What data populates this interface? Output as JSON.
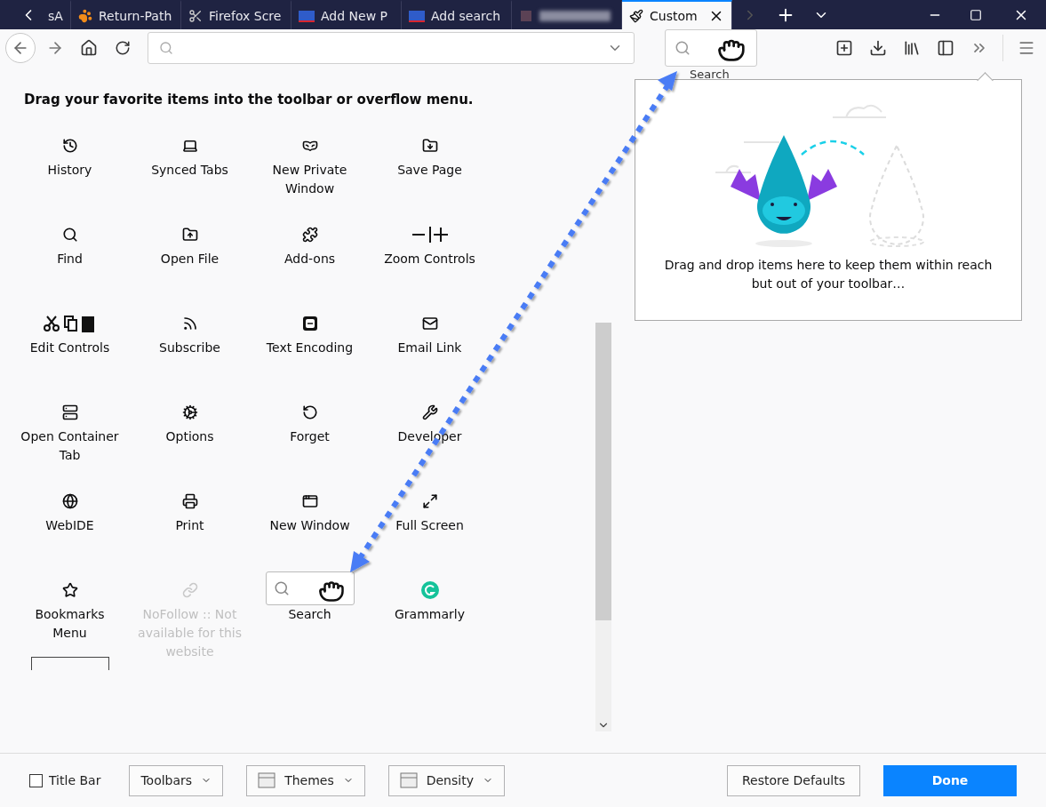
{
  "tabs": [
    {
      "kind": "text",
      "label": "sA",
      "selected": false
    },
    {
      "kind": "text",
      "label": "Return-Path",
      "selected": false
    },
    {
      "kind": "text",
      "label": "Firefox Scre",
      "selected": false
    },
    {
      "kind": "text",
      "label": "Add New P",
      "selected": false
    },
    {
      "kind": "text",
      "label": "Add search",
      "selected": false
    },
    {
      "kind": "redacted",
      "selected": false
    },
    {
      "kind": "text",
      "label": "Custom",
      "selected": true
    }
  ],
  "toolbar": {
    "search_label": "Search"
  },
  "palette": {
    "heading": "Drag your favorite items into the toolbar or overflow menu.",
    "items": [
      {
        "label": "History",
        "kind": "button",
        "disabled": false
      },
      {
        "label": "Synced Tabs",
        "kind": "button",
        "disabled": false
      },
      {
        "label": "New Private Window",
        "kind": "button",
        "disabled": false
      },
      {
        "label": "Save Page",
        "kind": "button",
        "disabled": false
      },
      {
        "label": "Find",
        "kind": "button",
        "disabled": false
      },
      {
        "label": "Open File",
        "kind": "button",
        "disabled": false
      },
      {
        "label": "Add-ons",
        "kind": "button",
        "disabled": false
      },
      {
        "label": "Zoom Controls",
        "kind": "button",
        "disabled": false
      },
      {
        "label": "Edit Controls",
        "kind": "button",
        "disabled": false
      },
      {
        "label": "Subscribe",
        "kind": "button",
        "disabled": false
      },
      {
        "label": "Text Encoding",
        "kind": "button",
        "disabled": false
      },
      {
        "label": "Email Link",
        "kind": "button",
        "disabled": false
      },
      {
        "label": "Open Container Tab",
        "kind": "button",
        "disabled": false
      },
      {
        "label": "Options",
        "kind": "button",
        "disabled": false
      },
      {
        "label": "Forget",
        "kind": "button",
        "disabled": false
      },
      {
        "label": "Developer",
        "kind": "button",
        "disabled": false
      },
      {
        "label": "WebIDE",
        "kind": "button",
        "disabled": false
      },
      {
        "label": "Print",
        "kind": "button",
        "disabled": false
      },
      {
        "label": "New Window",
        "kind": "button",
        "disabled": false
      },
      {
        "label": "Full Screen",
        "kind": "button",
        "disabled": false
      },
      {
        "label": "Bookmarks Menu",
        "kind": "button",
        "disabled": false
      },
      {
        "label": "NoFollow :: Not available for this website",
        "kind": "button",
        "disabled": true
      },
      {
        "label": "Search",
        "kind": "search",
        "disabled": false
      },
      {
        "label": "Grammarly",
        "kind": "button",
        "disabled": false
      },
      {
        "kind": "spacer",
        "disabled": false
      }
    ]
  },
  "overflow_panel": {
    "message": "Drag and drop items here to keep them within reach but out of your toolbar…"
  },
  "footer": {
    "title_bar": {
      "label": "Title Bar",
      "checked": false
    },
    "dropdowns": [
      {
        "label": "Toolbars",
        "icon": false
      },
      {
        "label": "Themes",
        "icon": true
      },
      {
        "label": "Density",
        "icon": true
      }
    ],
    "restore": "Restore Defaults",
    "done": "Done"
  }
}
